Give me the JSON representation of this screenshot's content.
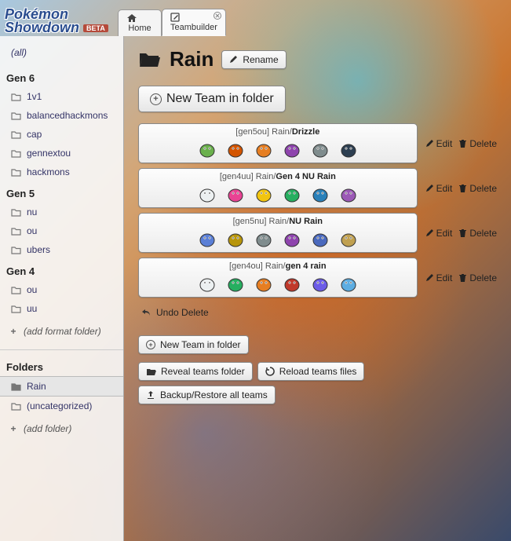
{
  "logo": {
    "line1": "Pokémon",
    "line2": "Showdown",
    "beta": "BETA"
  },
  "tabs": {
    "home": "Home",
    "teambuilder": "Teambuilder"
  },
  "sidebar": {
    "all": "(all)",
    "gens": [
      {
        "label": "Gen 6",
        "formats": [
          "1v1",
          "balancedhackmons",
          "cap",
          "gennextou",
          "hackmons"
        ]
      },
      {
        "label": "Gen 5",
        "formats": [
          "nu",
          "ou",
          "ubers"
        ]
      },
      {
        "label": "Gen 4",
        "formats": [
          "ou",
          "uu"
        ]
      }
    ],
    "add_format": "(add format folder)",
    "folders_heading": "Folders",
    "folders": [
      {
        "label": "Rain",
        "selected": true
      },
      {
        "label": "(uncategorized)",
        "selected": false
      }
    ],
    "add_folder": "(add folder)"
  },
  "content": {
    "folder_name": "Rain",
    "rename_label": "Rename",
    "new_team_big": "New Team in folder",
    "teams": [
      {
        "tag": "[gen5ou]",
        "folder": "Rain",
        "name": "Drizzle",
        "mons": [
          "#6ab04c",
          "#d35400",
          "#e67e22",
          "#8e44ad",
          "#7f8c8d",
          "#2c3e50"
        ]
      },
      {
        "tag": "[gen4uu]",
        "folder": "Rain",
        "name": "Gen 4 NU Rain",
        "mons": [
          "#ecf0f1",
          "#e84393",
          "#f1c40f",
          "#27ae60",
          "#2980b9",
          "#9b59b6"
        ]
      },
      {
        "tag": "[gen5nu]",
        "folder": "Rain",
        "name": "NU Rain",
        "mons": [
          "#5a7fd6",
          "#b7950b",
          "#7f8c8d",
          "#8e44ad",
          "#4a69bd",
          "#c0a050"
        ]
      },
      {
        "tag": "[gen4ou]",
        "folder": "Rain",
        "name": "gen 4 rain",
        "mons": [
          "#ecf0f1",
          "#27ae60",
          "#e67e22",
          "#c0392b",
          "#6c5ce7",
          "#5dade2"
        ]
      }
    ],
    "edit_label": "Edit",
    "delete_label": "Delete",
    "undo_label": "Undo Delete",
    "new_team_small": "New Team in folder",
    "reveal_label": "Reveal teams folder",
    "reload_label": "Reload teams files",
    "backup_label": "Backup/Restore all teams"
  }
}
